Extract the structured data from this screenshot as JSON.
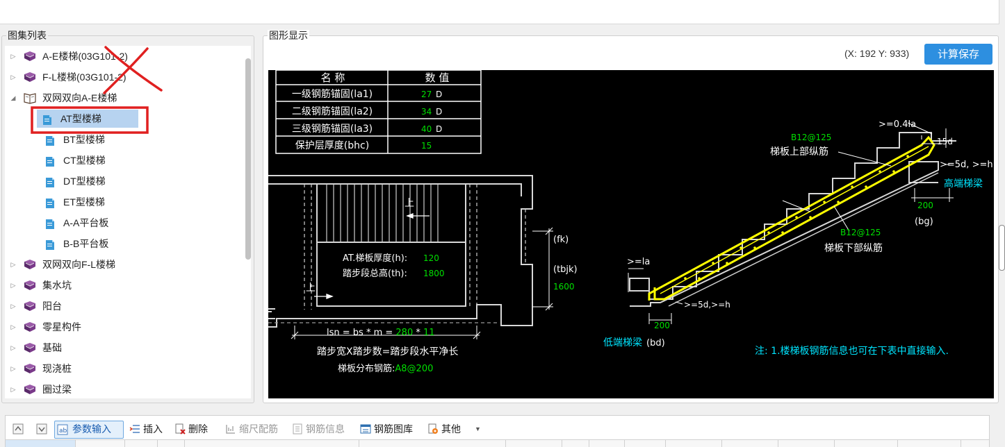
{
  "tree": {
    "title": "图集列表",
    "items": [
      {
        "label": "A-E楼梯(03G101-2)",
        "level": 0,
        "expanded": false,
        "icon": "book-icon"
      },
      {
        "label": "F-L楼梯(03G101-2)",
        "level": 0,
        "expanded": false,
        "icon": "book-icon"
      },
      {
        "label": "双网双向A-E楼梯",
        "level": 0,
        "expanded": true,
        "icon": "open-book-icon"
      },
      {
        "label": "AT型楼梯",
        "level": 1,
        "selected": true,
        "icon": "document-icon"
      },
      {
        "label": "BT型楼梯",
        "level": 1,
        "icon": "document-icon"
      },
      {
        "label": "CT型楼梯",
        "level": 1,
        "icon": "document-icon"
      },
      {
        "label": "DT型楼梯",
        "level": 1,
        "icon": "document-icon"
      },
      {
        "label": "ET型楼梯",
        "level": 1,
        "icon": "document-icon"
      },
      {
        "label": "A-A平台板",
        "level": 1,
        "icon": "document-icon"
      },
      {
        "label": "B-B平台板",
        "level": 1,
        "icon": "document-icon"
      },
      {
        "label": "双网双向F-L楼梯",
        "level": 0,
        "expanded": false,
        "icon": "book-icon"
      },
      {
        "label": "集水坑",
        "level": 0,
        "expanded": false,
        "icon": "book-icon"
      },
      {
        "label": "阳台",
        "level": 0,
        "expanded": false,
        "icon": "book-icon"
      },
      {
        "label": "零星构件",
        "level": 0,
        "expanded": false,
        "icon": "book-icon"
      },
      {
        "label": "基础",
        "level": 0,
        "expanded": false,
        "icon": "book-icon"
      },
      {
        "label": "现浇桩",
        "level": 0,
        "expanded": false,
        "icon": "book-icon"
      },
      {
        "label": "圈过梁",
        "level": 0,
        "expanded": false,
        "icon": "book-icon"
      }
    ]
  },
  "graphic": {
    "title": "图形显示",
    "coord": "(X: 192 Y: 933)",
    "calc_save": "计算保存",
    "table": {
      "headers": [
        "名 称",
        "数 值"
      ],
      "rows": [
        {
          "name": "一级钢筋锚固(la1)",
          "value": "27",
          "unit": "D"
        },
        {
          "name": "二级钢筋锚固(la2)",
          "value": "34",
          "unit": "D"
        },
        {
          "name": "三级钢筋锚固(la3)",
          "value": "40",
          "unit": "D"
        },
        {
          "name": "保护层厚度(bhc)",
          "value": "15",
          "unit": ""
        }
      ]
    },
    "plan": {
      "up1": "上",
      "up2": "上",
      "thickness_label": "AT.梯板厚度(h):",
      "thickness_value": "120",
      "height_label": "踏步段总高(th):",
      "height_value": "1800",
      "fk": "(fk)",
      "tbjk": "(tbjk)",
      "tbjk_value": "1600",
      "lsn_label": "lsn = bs * m = ",
      "lsn_bs": "280",
      "lsn_op": " * ",
      "lsn_m": "11",
      "formula": "踏步宽X踏步数=踏步段水平净长",
      "dist_label": "梯板分布钢筋:",
      "dist_value": "A8@200"
    },
    "section": {
      "top_bar_spec": "B12@125",
      "top_bar_name": "梯板上部纵筋",
      "bottom_bar_spec": "B12@125",
      "bottom_bar_name": "梯板下部纵筋",
      "anchor_top": ">=0.4la",
      "d15": "15d",
      "anchor_right": ">=5d, >=h",
      "high_beam": "高端梯梁",
      "bg_value": "200",
      "bg": "(bg)",
      "la": ">=la",
      "anchor_left": ">=5d,>=h",
      "bd_value": "200",
      "low_beam": "低端梯梁",
      "bd": "(bd)",
      "note": "注: 1.楼梯板钢筋信息也可在下表中直接输入."
    }
  },
  "toolbar": {
    "params": "参数输入",
    "insert": "插入",
    "delete": "删除",
    "scale": "缩尺配筋",
    "rebar_info": "钢筋信息",
    "rebar_lib": "钢筋图库",
    "other": "其他"
  },
  "colors": {
    "accent": "#2d8fe0",
    "cad_bg": "#000000",
    "cad_green": "#00e000",
    "cad_yellow": "#ffff00",
    "cad_cyan": "#00e5ff",
    "annotation_red": "#e02020"
  }
}
